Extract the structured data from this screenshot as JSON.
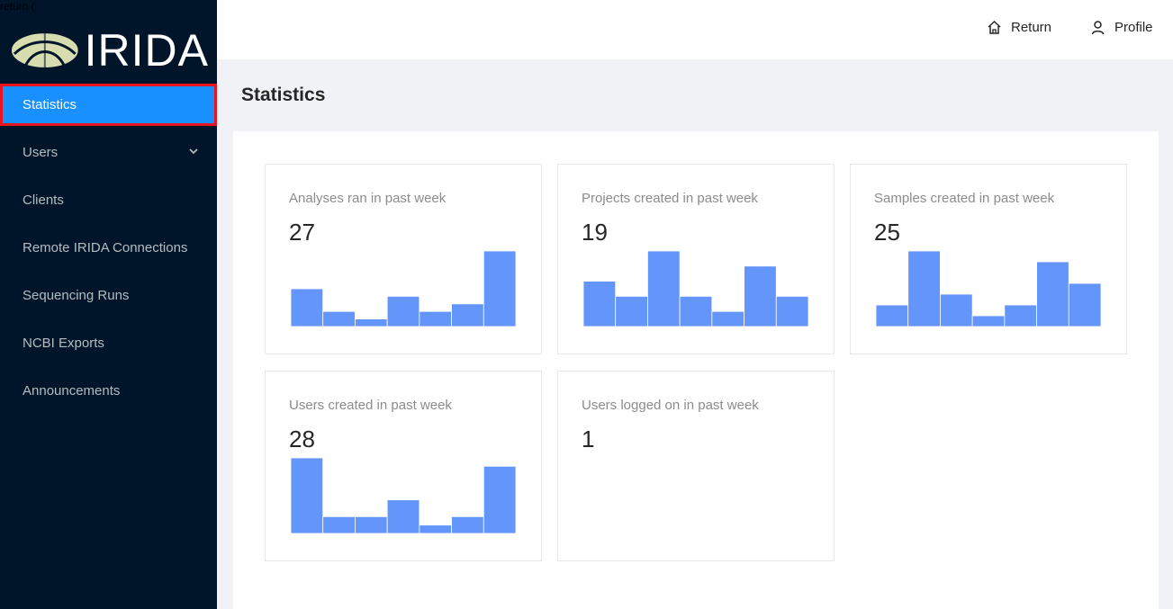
{
  "debug": {
    "text": "return ("
  },
  "brand": {
    "name": "IRIDA"
  },
  "sidebar": {
    "items": [
      {
        "label": "Statistics",
        "active": true
      },
      {
        "label": "Users",
        "has_submenu": true
      },
      {
        "label": "Clients"
      },
      {
        "label": "Remote IRIDA Connections"
      },
      {
        "label": "Sequencing Runs"
      },
      {
        "label": "NCBI Exports"
      },
      {
        "label": "Announcements"
      }
    ]
  },
  "header": {
    "return_label": "Return",
    "profile_label": "Profile"
  },
  "page": {
    "title": "Statistics"
  },
  "colors": {
    "sidebar_bg": "#001529",
    "active_item": "#1890ff",
    "active_outline": "#e8151c",
    "bar_fill": "#6495fa"
  },
  "chart_data": [
    {
      "type": "bar",
      "title": "Analyses ran in past week",
      "value": "27",
      "values": [
        5,
        2,
        1,
        4,
        2,
        3,
        10
      ],
      "ylim": [
        0,
        10
      ]
    },
    {
      "type": "bar",
      "title": "Projects created in past week",
      "value": "19",
      "values": [
        6,
        4,
        10,
        4,
        2,
        8,
        4
      ],
      "ylim": [
        0,
        10
      ]
    },
    {
      "type": "bar",
      "title": "Samples created in past week",
      "value": "25",
      "values": [
        2,
        7,
        3,
        1,
        2,
        6,
        4
      ],
      "ylim": [
        0,
        7
      ]
    },
    {
      "type": "bar",
      "title": "Users created in past week",
      "value": "28",
      "values": [
        9,
        2,
        2,
        4,
        1,
        2,
        8
      ],
      "ylim": [
        0,
        9
      ]
    },
    {
      "type": "bar",
      "title": "Users logged on in past week",
      "value": "1",
      "values": []
    }
  ]
}
